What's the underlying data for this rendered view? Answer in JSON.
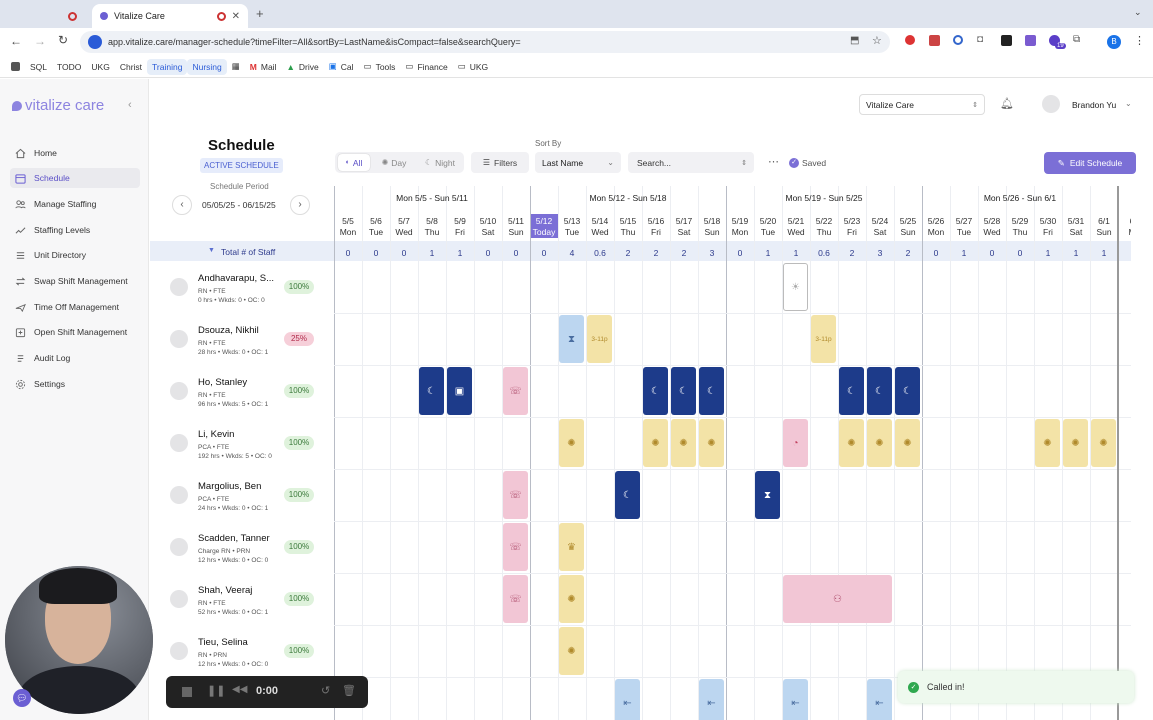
{
  "browser": {
    "tab1_title": "",
    "tab2_title": "Vitalize Care",
    "url": "app.vitalize.care/manager-schedule?timeFilter=All&sortBy=LastName&isCompact=false&searchQuery=",
    "profile_initial": "B",
    "ext_badge": "19",
    "bookmarks": [
      "SQL",
      "TODO",
      "UKG",
      "Christ",
      "Training",
      "Nursing",
      "Mail",
      "Drive",
      "Cal",
      "Tools",
      "Finance",
      "UKG"
    ]
  },
  "app": {
    "logo": "vitalize care",
    "org_select": "Vitalize Care",
    "user_name": "Brandon Yu"
  },
  "sidebar": {
    "items": [
      "Home",
      "Schedule",
      "Manage Staffing",
      "Staffing Levels",
      "Unit Directory",
      "Swap Shift Management",
      "Time Off Management",
      "Open Shift Management",
      "Audit Log",
      "Settings"
    ],
    "active_index": 1
  },
  "schedule": {
    "title": "Schedule",
    "badge": "ACTIVE SCHEDULE",
    "period_label": "Schedule Period",
    "period_value": "05/05/25 - 06/15/25",
    "filter_all": "All",
    "filter_day": "Day",
    "filter_night": "Night",
    "filters_btn": "Filters",
    "sort_label": "Sort By",
    "sort_value": "Last Name",
    "search_placeholder": "Search...",
    "saved": "Saved",
    "edit_btn": "Edit Schedule",
    "total_label": "Total # of Staff",
    "weeks": [
      "Mon 5/5 - Sun 5/11",
      "Mon 5/12 - Sun 5/18",
      "Mon 5/19 - Sun 5/25",
      "Mon 5/26 - Sun 6/1"
    ],
    "days": [
      {
        "d": "5/5",
        "w": "Mon"
      },
      {
        "d": "5/6",
        "w": "Tue"
      },
      {
        "d": "5/7",
        "w": "Wed"
      },
      {
        "d": "5/8",
        "w": "Thu"
      },
      {
        "d": "5/9",
        "w": "Fri"
      },
      {
        "d": "5/10",
        "w": "Sat"
      },
      {
        "d": "5/11",
        "w": "Sun"
      },
      {
        "d": "5/12",
        "w": "Today"
      },
      {
        "d": "5/13",
        "w": "Tue"
      },
      {
        "d": "5/14",
        "w": "Wed"
      },
      {
        "d": "5/15",
        "w": "Thu"
      },
      {
        "d": "5/16",
        "w": "Fri"
      },
      {
        "d": "5/17",
        "w": "Sat"
      },
      {
        "d": "5/18",
        "w": "Sun"
      },
      {
        "d": "5/19",
        "w": "Mon"
      },
      {
        "d": "5/20",
        "w": "Tue"
      },
      {
        "d": "5/21",
        "w": "Wed"
      },
      {
        "d": "5/22",
        "w": "Thu"
      },
      {
        "d": "5/23",
        "w": "Fri"
      },
      {
        "d": "5/24",
        "w": "Sat"
      },
      {
        "d": "5/25",
        "w": "Sun"
      },
      {
        "d": "5/26",
        "w": "Mon"
      },
      {
        "d": "5/27",
        "w": "Tue"
      },
      {
        "d": "5/28",
        "w": "Wed"
      },
      {
        "d": "5/29",
        "w": "Thu"
      },
      {
        "d": "5/30",
        "w": "Fri"
      },
      {
        "d": "5/31",
        "w": "Sat"
      },
      {
        "d": "6/1",
        "w": "Sun"
      },
      {
        "d": "6",
        "w": "M"
      }
    ],
    "totals": [
      "0",
      "0",
      "0",
      "1",
      "1",
      "0",
      "0",
      "0",
      "4",
      "0.6",
      "2",
      "2",
      "2",
      "3",
      "0",
      "1",
      "1",
      "0.6",
      "2",
      "3",
      "2",
      "0",
      "1",
      "0",
      "0",
      "1",
      "1",
      "1",
      ""
    ],
    "staff": [
      {
        "name": "Andhavarapu, S...",
        "role": "RN • FTE",
        "stats": "0 hrs • Wkds: 0 • OC: 0",
        "pct": "100%"
      },
      {
        "name": "Dsouza, Nikhil",
        "role": "RN • FTE",
        "stats": "28 hrs • Wkds: 0 • OC: 1",
        "pct": "25%"
      },
      {
        "name": "Ho, Stanley",
        "role": "RN • FTE",
        "stats": "96 hrs • Wkds: 5 • OC: 1",
        "pct": "100%"
      },
      {
        "name": "Li, Kevin",
        "role": "PCA • FTE",
        "stats": "192 hrs • Wkds: 5 • OC: 0",
        "pct": "100%"
      },
      {
        "name": "Margolius, Ben",
        "role": "PCA • FTE",
        "stats": "24 hrs • Wkds: 0 • OC: 1",
        "pct": "100%"
      },
      {
        "name": "Scadden, Tanner",
        "role": "Charge RN • PRN",
        "stats": "12 hrs • Wkds: 0 • OC: 0",
        "pct": "100%"
      },
      {
        "name": "Shah, Veeraj",
        "role": "RN • FTE",
        "stats": "52 hrs • Wkds: 0 • OC: 1",
        "pct": "100%"
      },
      {
        "name": "Tieu, Selina",
        "role": "RN • PRN",
        "stats": "12 hrs • Wkds: 0 • OC: 0",
        "pct": "100%"
      }
    ],
    "shift_text_1": "3-11p",
    "shift_text_2": "3-11p"
  },
  "toast": {
    "text": "Called in!"
  },
  "recorder": {
    "time": "0:00"
  },
  "colors": {
    "accent": "#7b6fd6",
    "night": "#1d3b8a",
    "day": "#f3e3a7",
    "pink": "#f2c6d5",
    "blue": "#bcd6f0",
    "green_pill": "#dff2dc",
    "red_pill": "#f6cfd9"
  }
}
